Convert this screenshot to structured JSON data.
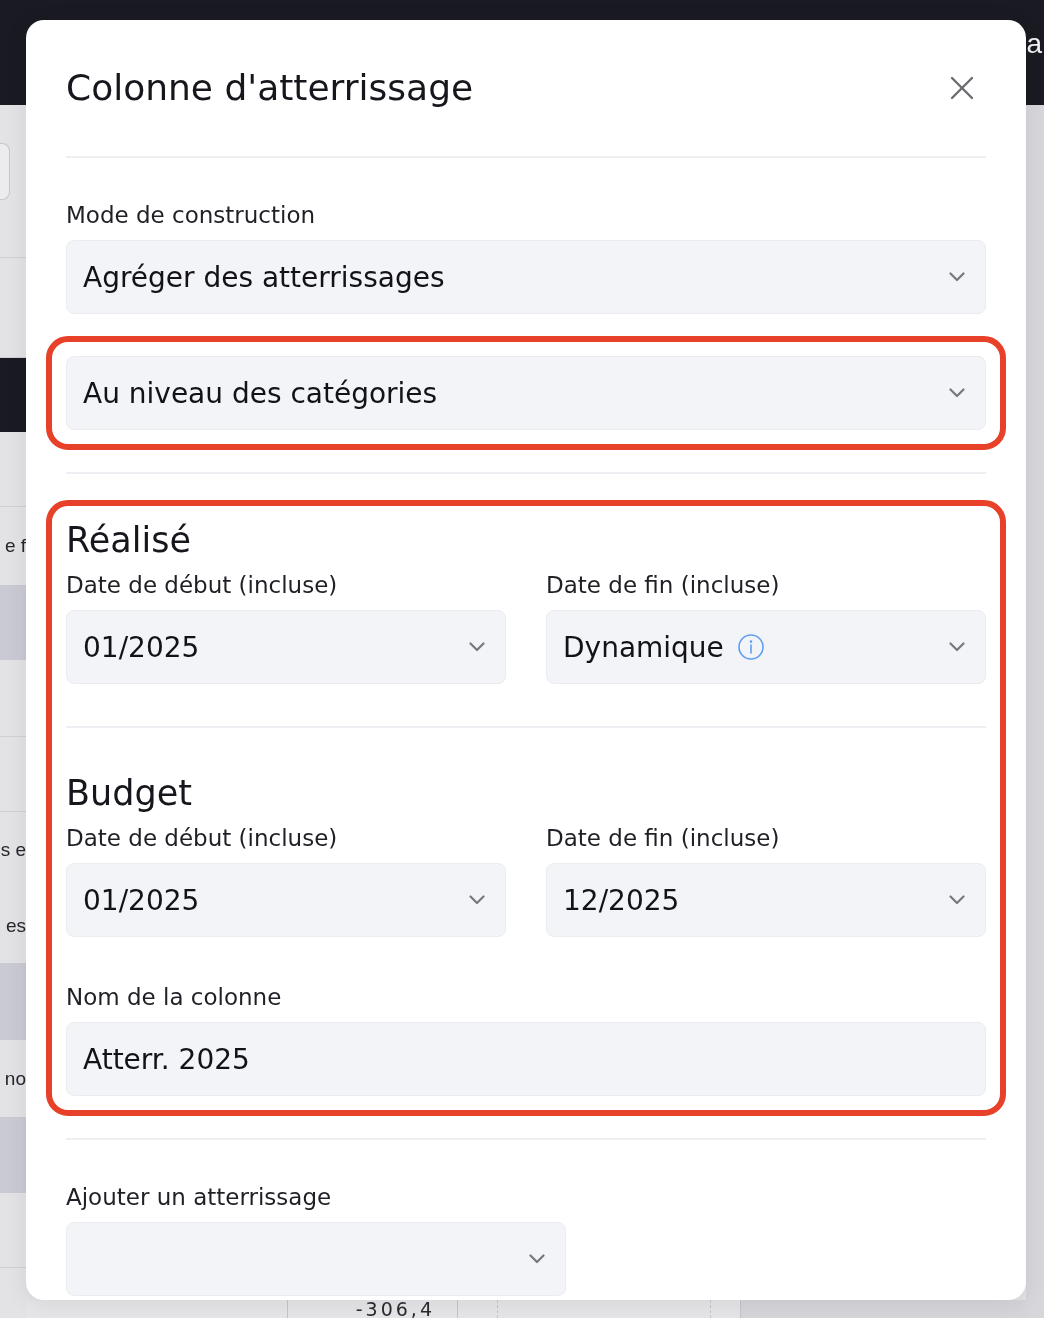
{
  "backdrop": {
    "header_text": "a",
    "side_texts": [
      "e f",
      "s e",
      "es",
      "no"
    ],
    "table_value": "-306,4"
  },
  "dialog": {
    "title": "Colonne d'atterrissage"
  },
  "build_mode": {
    "label": "Mode de construction",
    "value": "Agréger des atterrissages"
  },
  "aggregation_level": {
    "value": "Au niveau des catégories",
    "highlighted": true
  },
  "period_panel": {
    "highlighted": true,
    "sections": [
      {
        "heading": "Réalisé",
        "start": {
          "label": "Date de début (incluse)",
          "value": "01/2025"
        },
        "end": {
          "label": "Date de fin (incluse)",
          "value": "Dynamique",
          "info": true
        }
      },
      {
        "heading": "Budget",
        "start": {
          "label": "Date de début (incluse)",
          "value": "01/2025"
        },
        "end": {
          "label": "Date de fin (incluse)",
          "value": "12/2025",
          "info": false
        }
      }
    ],
    "column_name": {
      "label": "Nom de la colonne",
      "value": "Atterr. 2025"
    }
  },
  "add_landing": {
    "label": "Ajouter un atterrissage"
  }
}
